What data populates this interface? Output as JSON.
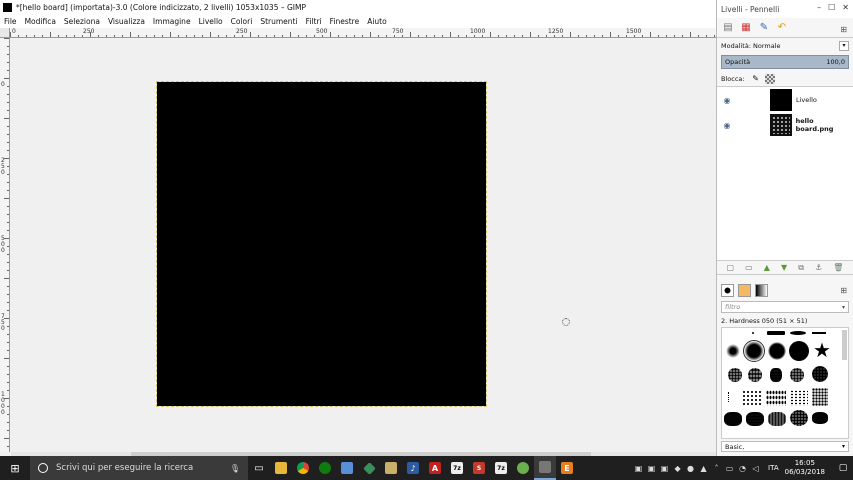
{
  "window": {
    "title": "*[hello board] (importata)-3.0 (Colore indicizzato, 2 livelli) 1053x1035 – GIMP"
  },
  "menu": [
    "File",
    "Modifica",
    "Seleziona",
    "Visualizza",
    "Immagine",
    "Livello",
    "Colori",
    "Strumenti",
    "Filtri",
    "Finestre",
    "Aiuto"
  ],
  "ruler_h_labels": [
    "0",
    "250",
    "250",
    "500",
    "750",
    "1000",
    "1250",
    "1500"
  ],
  "ruler_v_labels": [
    "0",
    "250",
    "500",
    "750",
    "1000"
  ],
  "dock": {
    "title": "Livelli - Pennelli",
    "mode_label": "Modalità:",
    "mode_value": "Normale",
    "opacity_label": "Opacità",
    "opacity_value": "100,0",
    "lock_label": "Blocca:",
    "layers": [
      {
        "name": "Livello",
        "visible": true,
        "bold": false
      },
      {
        "name": "hello board.png",
        "visible": true,
        "bold": true
      }
    ],
    "filter_placeholder": "filtro",
    "brush_name": "2. Hardness 050 (51 × 51)",
    "preset": "Basic,"
  },
  "taskbar": {
    "search_placeholder": "Scrivi qui per eseguire la ricerca",
    "language": "ITA",
    "time": "16:05",
    "date": "06/03/2018"
  },
  "colors": {
    "canvas_bg": "#f0f0f0",
    "image_fill": "#000000",
    "taskbar_bg": "#1f1f1f",
    "opacity_bar": "#a8b8c8"
  }
}
